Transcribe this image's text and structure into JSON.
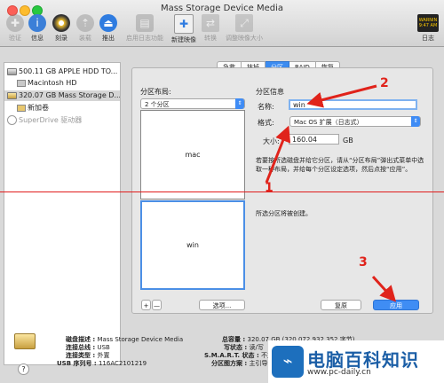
{
  "window": {
    "title": "Mass Storage Device Media"
  },
  "toolbar": [
    {
      "label": "验证",
      "icon": "stethoscope-icon",
      "enabled": false
    },
    {
      "label": "信息",
      "icon": "info-icon",
      "enabled": true
    },
    {
      "label": "刻录",
      "icon": "burn-icon",
      "enabled": true
    },
    {
      "label": "装载",
      "icon": "mount-icon",
      "enabled": false
    },
    {
      "label": "推出",
      "icon": "eject-icon",
      "enabled": true
    },
    {
      "label": "启用日志功能",
      "icon": "journal-icon",
      "enabled": false
    },
    {
      "label": "新建映像",
      "icon": "new-image-icon",
      "enabled": true
    },
    {
      "label": "转换",
      "icon": "convert-icon",
      "enabled": false
    },
    {
      "label": "调整映像大小",
      "icon": "resize-image-icon",
      "enabled": false
    },
    {
      "label": "日志",
      "icon": "log-icon",
      "enabled": true
    }
  ],
  "log_badge": "WARNIN\n9:47 AM",
  "sidebar": {
    "items": [
      {
        "label": "500.11 GB APPLE HDD TO...",
        "kind": "drive",
        "selected": false
      },
      {
        "label": "Macintosh HD",
        "kind": "volume",
        "selected": false
      },
      {
        "label": "320.07 GB Mass Storage D...",
        "kind": "drive",
        "selected": true
      },
      {
        "label": "新加卷",
        "kind": "volume",
        "selected": false
      },
      {
        "label": "SuperDrive 驱动器",
        "kind": "superdrive",
        "selected": false
      }
    ]
  },
  "tabs": [
    {
      "label": "急救",
      "active": false
    },
    {
      "label": "抹掉",
      "active": false
    },
    {
      "label": "分区",
      "active": true
    },
    {
      "label": "RAID",
      "active": false
    },
    {
      "label": "恢复",
      "active": false
    }
  ],
  "layout_section": {
    "title": "分区布局:",
    "select_value": "2 个分区",
    "partitions": [
      "mac",
      "win"
    ],
    "plus": "+",
    "minus": "—",
    "options_button": "选项..."
  },
  "info_section": {
    "title": "分区信息",
    "name_label": "名称:",
    "name_value": "win",
    "format_label": "格式:",
    "format_value": "Mac OS 扩展（日志式）",
    "size_label": "大小:",
    "size_value": "160.04",
    "size_unit": "GB",
    "help_text": "若要按所选磁盘并给它分区，请从“分区布局”弹出式菜单中选取一种布局，并给每个分区设定选项，然后点按“应用”。",
    "status_text": "所选分区将被创建。",
    "revert_button": "复原",
    "apply_button": "应用"
  },
  "footer": {
    "disk_desc_label": "磁盘描述 :",
    "disk_desc": "Mass Storage Device Media",
    "bus_label": "连接总线 :",
    "bus": "USB",
    "conn_type_label": "连接类型 :",
    "conn_type": "外置",
    "serial_label": "USB 序列号 :",
    "serial": "116AC2101219",
    "capacity_label": "总容量 :",
    "capacity": "320.07 GB (320,072,932,352 字节)",
    "write_label": "写状态 :",
    "write": "读/写",
    "smart_label": "S.M.A.R.T. 状态 :",
    "smart": "不支持",
    "scheme_label": "分区图方案 :",
    "scheme": "主引导记录"
  },
  "annotations": [
    "1",
    "2",
    "3"
  ],
  "watermark": {
    "name": "电脑百科知识",
    "url": "www.pc-daily.cn"
  },
  "colors": {
    "accent": "#3b8bf0",
    "annotation": "#e0231b"
  }
}
